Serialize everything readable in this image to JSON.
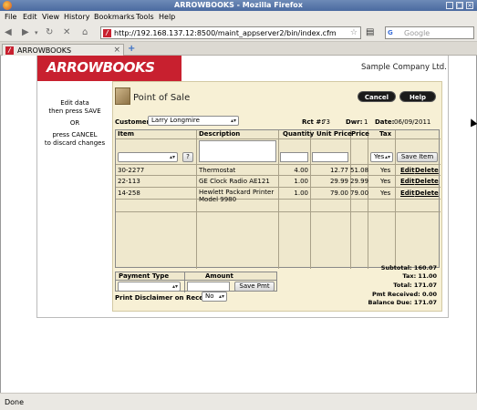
{
  "window": {
    "title": "ARROWBOOKS - Mozilla Firefox"
  },
  "menu": {
    "file": "File",
    "edit": "Edit",
    "view": "View",
    "history": "History",
    "bookmarks": "Bookmarks",
    "tools": "Tools",
    "help": "Help"
  },
  "nav": {
    "url": "http://192.168.137.12:8500/maint_appserver2/bin/index.cfm",
    "search_placeholder": "Google",
    "search_engine": "G"
  },
  "tab": {
    "label": "ARROWBOOKS",
    "new": "+"
  },
  "header": {
    "logo": "ARROWBOOKS",
    "company": "Sample Company Ltd."
  },
  "instructions": {
    "line1": "Edit data",
    "line2": "then press SAVE",
    "line3": "OR",
    "line4": "press CANCEL",
    "line5": "to discard changes"
  },
  "pos": {
    "title": "Point of Sale",
    "cancel": "Cancel",
    "help": "Help",
    "customer_label": "Customer:",
    "customer_value": "Larry Longmire",
    "rct_label": "Rct #:",
    "rct_value": "73",
    "dwr_label": "Dwr:",
    "dwr_value": "1",
    "date_label": "Date:",
    "date_value": "06/09/2011",
    "columns": {
      "item": "Item",
      "description": "Description",
      "quantity": "Quantity",
      "unit_price": "Unit Price",
      "price": "Price",
      "tax": "Tax"
    },
    "entry": {
      "lookup": "?",
      "tax_value": "Yes",
      "save_item": "Save Item"
    },
    "rows": [
      {
        "item": "30-2277",
        "desc1": "Thermostat",
        "desc2": "",
        "qty": "4.00",
        "unit": "12.77",
        "price": "51.08",
        "tax": "Yes",
        "edit": "Edit",
        "delete": "Delete"
      },
      {
        "item": "22-113",
        "desc1": "GE Clock Radio AE121",
        "desc2": "",
        "qty": "1.00",
        "unit": "29.99",
        "price": "29.99",
        "tax": "Yes",
        "edit": "Edit",
        "delete": "Delete"
      },
      {
        "item": "14-258",
        "desc1": "Hewlett Packard Printer",
        "desc2": "Model 9980",
        "qty": "1.00",
        "unit": "79.00",
        "price": "79.00",
        "tax": "Yes",
        "edit": "Edit",
        "delete": "Delete"
      }
    ],
    "payment": {
      "type_label": "Payment Type",
      "amount_label": "Amount",
      "save_pmt": "Save Pmt",
      "disclaimer_label": "Print Disclaimer on Receipt:",
      "disclaimer_value": "No"
    },
    "totals": {
      "subtotal": "Subtotal: 160.07",
      "tax": "Tax: 11.00",
      "total": "Total: 171.07",
      "pmt_received": "Pmt Received: 0.00",
      "balance_due": "Balance Due: 171.07"
    }
  },
  "status": {
    "text": "Done"
  }
}
